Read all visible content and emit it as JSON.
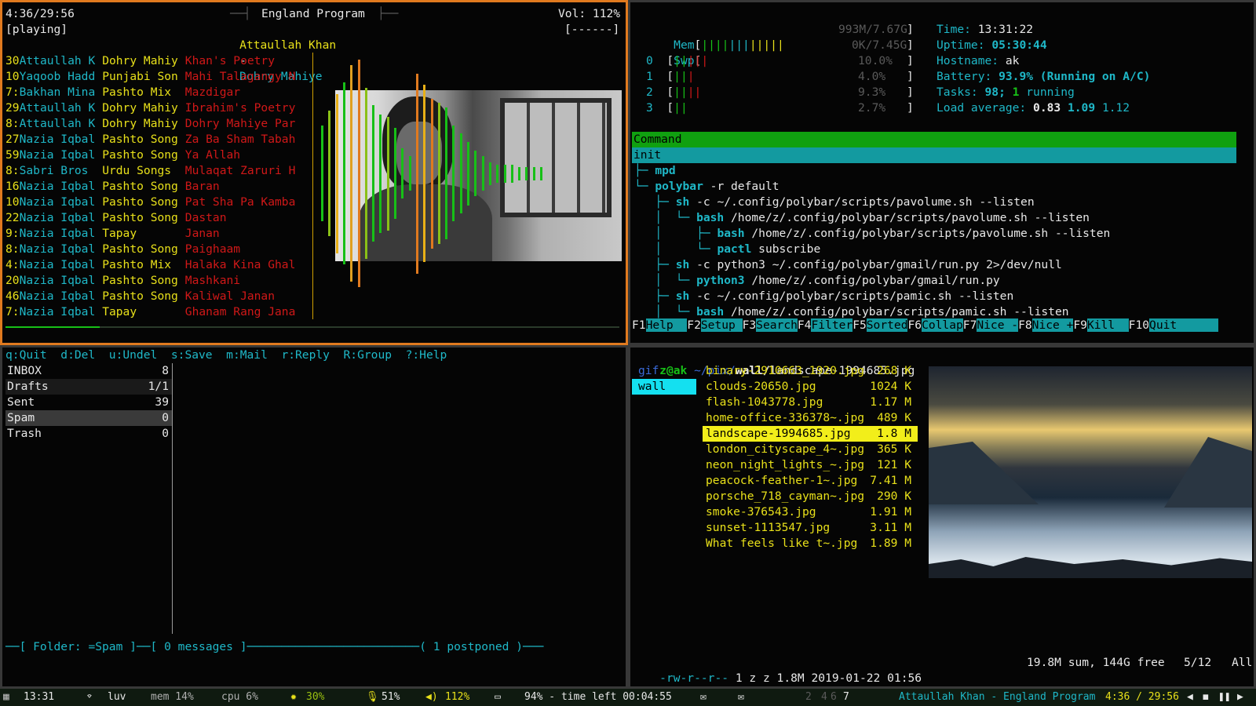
{
  "colors": {
    "focus_border": "#e07a1f",
    "cyan": "#1fb8c8",
    "yellow": "#e8e01a",
    "red": "#d01818",
    "green": "#17c017",
    "teal_bar": "#139aa0"
  },
  "player": {
    "time": "4:36/29:56",
    "state": "[playing]",
    "album": "England Program",
    "volume": "Vol: 112%",
    "vol_bar": "[------]",
    "artist": "Attaullah Khan",
    "sep": "-",
    "title": "Dohry Mahiye",
    "playlist": [
      {
        "num": "30",
        "artist": "Attaullah K",
        "album": "Dohry Mahiy",
        "title": "Khan's Poetry"
      },
      {
        "num": "10",
        "artist": "Yaqoob Hadd",
        "album": "Punjabi Son",
        "title": "Mahi Talagangy N"
      },
      {
        "num": "7:",
        "artist": "Bakhan Mina",
        "album": "Pashto Mix",
        "title": "Mazdigar"
      },
      {
        "num": "29",
        "artist": "Attaullah K",
        "album": "Dohry Mahiy",
        "title": "Ibrahim's Poetry"
      },
      {
        "num": "8:",
        "artist": "Attaullah K",
        "album": "Dohry Mahiy",
        "title": "Dohry Mahiye Par"
      },
      {
        "num": "27",
        "artist": "Nazia Iqbal",
        "album": "Pashto Song",
        "title": "Za Ba Sham Tabah"
      },
      {
        "num": "59",
        "artist": "Nazia Iqbal",
        "album": "Pashto Song",
        "title": "Ya Allah"
      },
      {
        "num": "8:",
        "artist": "Sabri Bros",
        "album": "Urdu Songs",
        "title": "Mulaqat Zaruri H"
      },
      {
        "num": "16",
        "artist": "Nazia Iqbal",
        "album": "Pashto Song",
        "title": "Baran"
      },
      {
        "num": "10",
        "artist": "Nazia Iqbal",
        "album": "Pashto Song",
        "title": "Pat Sha Pa Kamba"
      },
      {
        "num": "22",
        "artist": "Nazia Iqbal",
        "album": "Pashto Song",
        "title": "Dastan"
      },
      {
        "num": "9:",
        "artist": "Nazia Iqbal",
        "album": "Tapay",
        "title": "Janan"
      },
      {
        "num": "8:",
        "artist": "Nazia Iqbal",
        "album": "Pashto Song",
        "title": "Paighaam"
      },
      {
        "num": "4:",
        "artist": "Nazia Iqbal",
        "album": "Pashto Mix",
        "title": "Halaka Kina Ghal"
      },
      {
        "num": "20",
        "artist": "Nazia Iqbal",
        "album": "Pashto Song",
        "title": "Mashkani"
      },
      {
        "num": "46",
        "artist": "Nazia Iqbal",
        "album": "Pashto Song",
        "title": "Kaliwal Janan"
      },
      {
        "num": "7:",
        "artist": "Nazia Iqbal",
        "album": "Tapay",
        "title": "Ghanam Rang Jana"
      }
    ],
    "progress": 0.154,
    "visualizer": [
      {
        "c": "#17c017",
        "h": 0.42
      },
      {
        "c": "#8ac017",
        "h": 0.55
      },
      {
        "c": "#e8b017",
        "h": 0.7
      },
      {
        "c": "#17c017",
        "h": 0.8
      },
      {
        "c": "#e0a020",
        "h": 0.95
      },
      {
        "c": "#e07a1f",
        "h": 1.0
      },
      {
        "c": "#8ac017",
        "h": 0.75
      },
      {
        "c": "#17c017",
        "h": 0.6
      },
      {
        "c": "#17c017",
        "h": 0.52
      },
      {
        "c": "#8ac017",
        "h": 0.5
      },
      {
        "c": "#17c017",
        "h": 0.4
      },
      {
        "c": "#17c017",
        "h": 0.22
      },
      {
        "c": "#17c017",
        "h": 0.15
      },
      {
        "c": "#e07a1f",
        "h": 0.88
      },
      {
        "c": "#e8b017",
        "h": 0.78
      },
      {
        "c": "#e07a1f",
        "h": 0.66
      },
      {
        "c": "#8ac017",
        "h": 0.62
      },
      {
        "c": "#17c017",
        "h": 0.58
      },
      {
        "c": "#17c017",
        "h": 0.42
      },
      {
        "c": "#17c017",
        "h": 0.35
      },
      {
        "c": "#17c017",
        "h": 0.28
      },
      {
        "c": "#17c017",
        "h": 0.2
      },
      {
        "c": "#17c017",
        "h": 0.15
      },
      {
        "c": "#17c017",
        "h": 0.1
      },
      {
        "c": "#17c017",
        "h": 0.08
      },
      {
        "c": "#17c017",
        "h": 0.08
      },
      {
        "c": "#17c017",
        "h": 0.08
      },
      {
        "c": "#17c017",
        "h": 0.06
      },
      {
        "c": "#17c017",
        "h": 0.06
      },
      {
        "c": "#17c017",
        "h": 0.06
      },
      {
        "c": "#17c017",
        "h": 0.06
      }
    ]
  },
  "htop": {
    "mem_label": "Mem",
    "mem_val": "993M/7.67G",
    "swp_label": "Swp",
    "swp_val": "0K/7.45G",
    "cpus": [
      {
        "n": "0",
        "val": "10.0%",
        "fill": 0.25
      },
      {
        "n": "1",
        "val": "4.0%",
        "fill": 0.15
      },
      {
        "n": "2",
        "val": "9.3%",
        "fill": 0.23
      },
      {
        "n": "3",
        "val": "2.7%",
        "fill": 0.1
      }
    ],
    "time_label": "Time:",
    "time": "13:31:22",
    "uptime_label": "Uptime:",
    "uptime": "05:30:44",
    "host_label": "Hostname:",
    "host": "ak",
    "batt_label": "Battery:",
    "batt": "93.9% (Running on A/C)",
    "tasks_label": "Tasks:",
    "tasks": "98;",
    "running_n": "1",
    "running": "running",
    "load_label": "Load average:",
    "load1": "0.83",
    "load5": "1.09",
    "load15": "1.12",
    "header": "Command",
    "selected": "init",
    "tree": [
      {
        "p": "├─ ",
        "c": "mpd",
        "a": ""
      },
      {
        "p": "└─ ",
        "c": "polybar",
        "a": " -r default"
      },
      {
        "p": "   ├─ ",
        "c": "sh",
        "a": " -c ~/.config/polybar/scripts/pavolume.sh --listen"
      },
      {
        "p": "   │  └─ ",
        "c": "bash",
        "a": " /home/z/.config/polybar/scripts/pavolume.sh --listen"
      },
      {
        "p": "   │     ├─ ",
        "c": "bash",
        "a": " /home/z/.config/polybar/scripts/pavolume.sh --listen"
      },
      {
        "p": "   │     └─ ",
        "c": "pactl",
        "a": " subscribe"
      },
      {
        "p": "   ├─ ",
        "c": "sh",
        "a": " -c python3 ~/.config/polybar/gmail/run.py 2>/dev/null"
      },
      {
        "p": "   │  └─ ",
        "c": "python3",
        "a": " /home/z/.config/polybar/gmail/run.py"
      },
      {
        "p": "   ├─ ",
        "c": "sh",
        "a": " -c ~/.config/polybar/scripts/pamic.sh --listen"
      },
      {
        "p": "   │  └─ ",
        "c": "bash",
        "a": " /home/z/.config/polybar/scripts/pamic.sh --listen"
      }
    ],
    "fkeys": [
      {
        "k": "F1",
        "v": "Help  "
      },
      {
        "k": "F2",
        "v": "Setup "
      },
      {
        "k": "F3",
        "v": "Search"
      },
      {
        "k": "F4",
        "v": "Filter"
      },
      {
        "k": "F5",
        "v": "Sorted"
      },
      {
        "k": "F6",
        "v": "Collap"
      },
      {
        "k": "F7",
        "v": "Nice -"
      },
      {
        "k": "F8",
        "v": "Nice +"
      },
      {
        "k": "F9",
        "v": "Kill  "
      },
      {
        "k": "F10",
        "v": "Quit      "
      }
    ]
  },
  "mutt": {
    "help": "q:Quit  d:Del  u:Undel  s:Save  m:Mail  r:Reply  R:Group  ?:Help",
    "folders": [
      {
        "name": "INBOX",
        "count": "8"
      },
      {
        "name": "Drafts",
        "count": "1/1"
      },
      {
        "name": "Sent",
        "count": "39"
      },
      {
        "name": "Spam",
        "count": "0"
      },
      {
        "name": "Trash",
        "count": "0"
      }
    ],
    "status_folder": "[ Folder: =Spam ]",
    "status_msgs": "[ 0 messages ]",
    "status_post": "( 1 postponed )"
  },
  "ranger": {
    "user": "z@ak",
    "path": "~/pix/",
    "dir": "wall/",
    "file": "landscape-1994685.jpg",
    "parents": [
      "gif",
      "wall"
    ],
    "files": [
      {
        "name": "binary-2910663_1920.jpg",
        "size": "268 K"
      },
      {
        "name": "clouds-20650.jpg",
        "size": "1024 K"
      },
      {
        "name": "flash-1043778.jpg",
        "size": "1.17 M"
      },
      {
        "name": "home-office-336378~.jpg",
        "size": "489 K"
      },
      {
        "name": "landscape-1994685.jpg",
        "size": "1.8 M"
      },
      {
        "name": "london_cityscape_4~.jpg",
        "size": "365 K"
      },
      {
        "name": "neon_night_lights_~.jpg",
        "size": "121 K"
      },
      {
        "name": "peacock-feather-1~.jpg",
        "size": "7.41 M"
      },
      {
        "name": "porsche_718_cayman~.jpg",
        "size": "290 K"
      },
      {
        "name": "smoke-376543.jpg",
        "size": "1.91 M"
      },
      {
        "name": "sunset-1113547.jpg",
        "size": "3.11 M"
      },
      {
        "name": "What feels like t~.jpg",
        "size": "1.89 M"
      }
    ],
    "selected_index": 4,
    "perm": "-rw-r--r--",
    "status": "1 z z 1.8M 2019-01-22 01:56",
    "sum": "19.8M sum, 144G free",
    "pos": "5/12",
    "all": "All"
  },
  "bar": {
    "clock": "13:31",
    "wifi": "luv",
    "mem": "mem 14%",
    "cpu": "cpu 6%",
    "brightness": "30%",
    "mic": "51%",
    "vol": "112%",
    "battery": "94% - time left 00:04:55",
    "ws": [
      "2",
      "4",
      "6",
      "7"
    ],
    "now_playing": "Attaullah Khan - England Program",
    "np_time": "4:36 / 29:56"
  }
}
